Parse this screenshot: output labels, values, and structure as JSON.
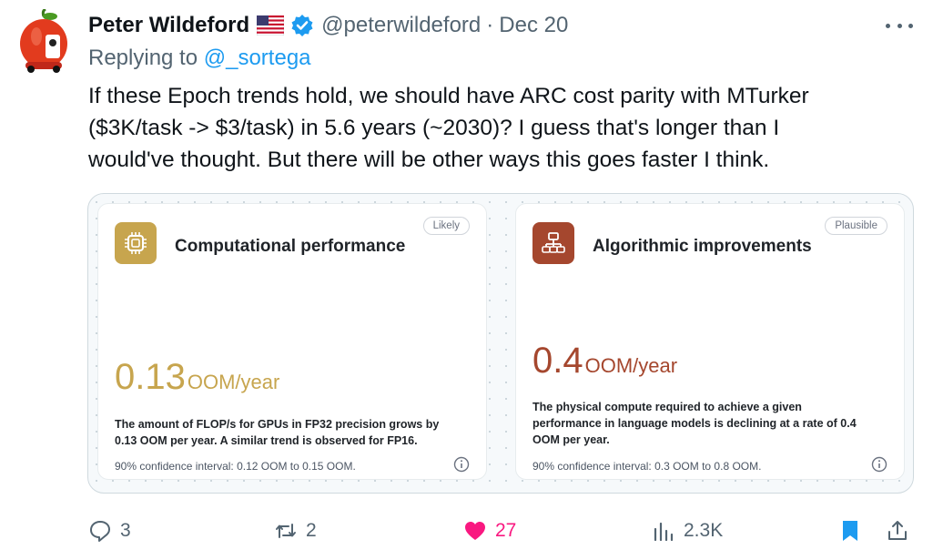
{
  "tweet": {
    "author_name": "Peter Wildeford",
    "handle": "@peterwildeford",
    "separator": "·",
    "date": "Dec 20",
    "replying_prefix": "Replying to ",
    "replying_to": "@_sortega",
    "text": "If these Epoch trends hold, we should have ARC cost parity with MTurker\n($3K/task -> $3/task) in 5.6 years (~2030)? I guess that's longer than I\nwould've thought. But there will be other ways this goes faster I think."
  },
  "media": {
    "cards": [
      {
        "icon": "chip-icon",
        "icon_color": "#c7a54e",
        "title": "Computational performance",
        "badge": "Likely",
        "value": "0.13",
        "unit": "OOM/year",
        "value_color": "#c7a54e",
        "description": "The amount of FLOP/s for GPUs in FP32 precision grows by 0.13 OOM per year. A similar trend is observed for FP16.",
        "confidence": "90% confidence interval: 0.12 OOM to 0.15 OOM."
      },
      {
        "icon": "hierarchy-icon",
        "icon_color": "#a5472e",
        "title": "Algorithmic improvements",
        "badge": "Plausible",
        "value": "0.4",
        "unit": "OOM/year",
        "value_color": "#a5472e",
        "description": "The physical compute required to achieve a given performance in language models is declining at a rate of 0.4 OOM per year.",
        "confidence": "90% confidence interval: 0.3 OOM to 0.8 OOM."
      }
    ]
  },
  "actions": {
    "replies": "3",
    "retweets": "2",
    "likes": "27",
    "views": "2.3K"
  },
  "colors": {
    "accent": "#1d9bf0",
    "like": "#f91880",
    "muted": "#536471"
  }
}
